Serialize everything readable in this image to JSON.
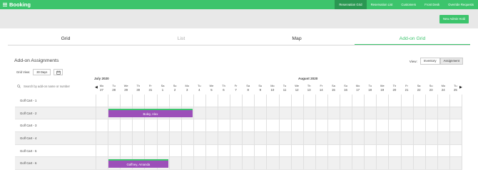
{
  "brand": {
    "name": "Booking"
  },
  "topnav": [
    {
      "label": "Reservation Grid",
      "active": true
    },
    {
      "label": "Reservation List",
      "active": false
    },
    {
      "label": "Customers",
      "active": false
    },
    {
      "label": "Front Desk",
      "active": false
    },
    {
      "label": "Override Requests",
      "active": false
    }
  ],
  "subbar": {
    "new_admin_hold": "New Admin Hold"
  },
  "tabs": [
    {
      "label": "Grid",
      "state": "normal"
    },
    {
      "label": "List",
      "state": "muted"
    },
    {
      "label": "Map",
      "state": "normal"
    },
    {
      "label": "Add-on Grid",
      "state": "active"
    }
  ],
  "section": {
    "title": "Add-on Assignments"
  },
  "view": {
    "label": "View:",
    "options": [
      {
        "label": "Inventory",
        "active": false
      },
      {
        "label": "Assignment",
        "active": true
      }
    ]
  },
  "gridview": {
    "label": "Grid View:",
    "selected": "30 Days"
  },
  "search": {
    "placeholder": "Search by add-on name or number"
  },
  "months": [
    {
      "label": "July 2020"
    },
    {
      "label": "August 2020"
    }
  ],
  "dates": [
    {
      "wd": "Mo",
      "d": "27"
    },
    {
      "wd": "Tu",
      "d": "28"
    },
    {
      "wd": "We",
      "d": "29"
    },
    {
      "wd": "Th",
      "d": "30"
    },
    {
      "wd": "Fr",
      "d": "31"
    },
    {
      "wd": "Sa",
      "d": "1"
    },
    {
      "wd": "Su",
      "d": "2"
    },
    {
      "wd": "Mo",
      "d": "3"
    },
    {
      "wd": "Tu",
      "d": "4"
    },
    {
      "wd": "We",
      "d": "5"
    },
    {
      "wd": "Th",
      "d": "6"
    },
    {
      "wd": "Fr",
      "d": "7"
    },
    {
      "wd": "Sa",
      "d": "8"
    },
    {
      "wd": "Su",
      "d": "9"
    },
    {
      "wd": "Mo",
      "d": "10"
    },
    {
      "wd": "Tu",
      "d": "11"
    },
    {
      "wd": "We",
      "d": "12"
    },
    {
      "wd": "Th",
      "d": "13"
    },
    {
      "wd": "Fr",
      "d": "14"
    },
    {
      "wd": "Sa",
      "d": "15"
    },
    {
      "wd": "Su",
      "d": "16"
    },
    {
      "wd": "Mo",
      "d": "17"
    },
    {
      "wd": "Tu",
      "d": "18"
    },
    {
      "wd": "We",
      "d": "19"
    },
    {
      "wd": "Th",
      "d": "20"
    },
    {
      "wd": "Fr",
      "d": "21"
    },
    {
      "wd": "Sa",
      "d": "22"
    },
    {
      "wd": "Su",
      "d": "23"
    },
    {
      "wd": "Mo",
      "d": "24"
    },
    {
      "wd": "Tu",
      "d": "25"
    }
  ],
  "rows": [
    {
      "label": "Golf Cart - 1"
    },
    {
      "label": "Golf Cart - 2"
    },
    {
      "label": "Golf Cart - 3"
    },
    {
      "label": "Golf Cart - 4"
    },
    {
      "label": "Golf Cart - 5"
    },
    {
      "label": "Golf Cart - 6"
    }
  ],
  "bookings": [
    {
      "name": "Boley, Alex",
      "row": 1,
      "start_day": "Jul 28",
      "end_day": "Aug 3"
    },
    {
      "name": "Gaffney, Amanda",
      "row": 5,
      "start_day": "Jul 28",
      "end_day": "Aug 1"
    }
  ],
  "colors": {
    "brand_green": "#3cc46c",
    "active_nav": "#2a9752",
    "booking": "#9c4fb9"
  }
}
